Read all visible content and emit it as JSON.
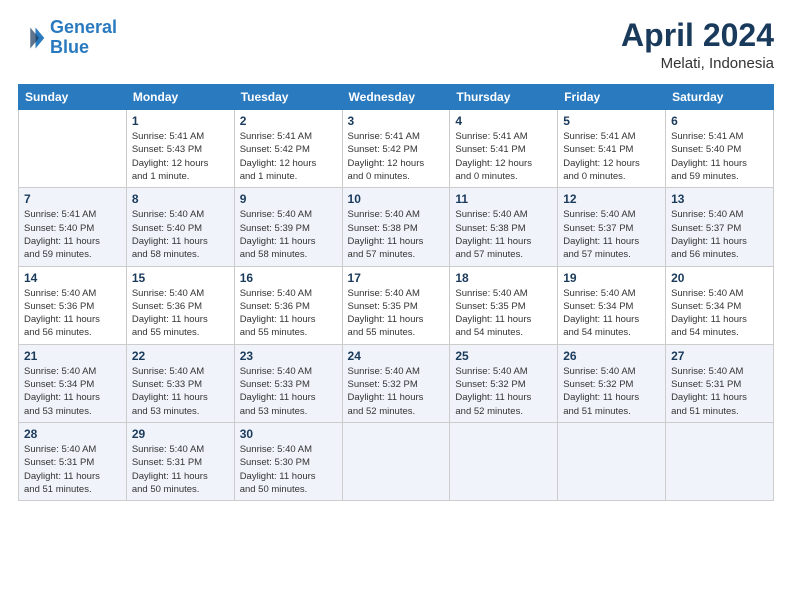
{
  "header": {
    "logo_line1": "General",
    "logo_line2": "Blue",
    "month": "April 2024",
    "location": "Melati, Indonesia"
  },
  "days_of_week": [
    "Sunday",
    "Monday",
    "Tuesday",
    "Wednesday",
    "Thursday",
    "Friday",
    "Saturday"
  ],
  "weeks": [
    [
      {
        "day": "",
        "info": ""
      },
      {
        "day": "1",
        "info": "Sunrise: 5:41 AM\nSunset: 5:43 PM\nDaylight: 12 hours\nand 1 minute."
      },
      {
        "day": "2",
        "info": "Sunrise: 5:41 AM\nSunset: 5:42 PM\nDaylight: 12 hours\nand 1 minute."
      },
      {
        "day": "3",
        "info": "Sunrise: 5:41 AM\nSunset: 5:42 PM\nDaylight: 12 hours\nand 0 minutes."
      },
      {
        "day": "4",
        "info": "Sunrise: 5:41 AM\nSunset: 5:41 PM\nDaylight: 12 hours\nand 0 minutes."
      },
      {
        "day": "5",
        "info": "Sunrise: 5:41 AM\nSunset: 5:41 PM\nDaylight: 12 hours\nand 0 minutes."
      },
      {
        "day": "6",
        "info": "Sunrise: 5:41 AM\nSunset: 5:40 PM\nDaylight: 11 hours\nand 59 minutes."
      }
    ],
    [
      {
        "day": "7",
        "info": "Sunrise: 5:41 AM\nSunset: 5:40 PM\nDaylight: 11 hours\nand 59 minutes."
      },
      {
        "day": "8",
        "info": "Sunrise: 5:40 AM\nSunset: 5:40 PM\nDaylight: 11 hours\nand 58 minutes."
      },
      {
        "day": "9",
        "info": "Sunrise: 5:40 AM\nSunset: 5:39 PM\nDaylight: 11 hours\nand 58 minutes."
      },
      {
        "day": "10",
        "info": "Sunrise: 5:40 AM\nSunset: 5:38 PM\nDaylight: 11 hours\nand 57 minutes."
      },
      {
        "day": "11",
        "info": "Sunrise: 5:40 AM\nSunset: 5:38 PM\nDaylight: 11 hours\nand 57 minutes."
      },
      {
        "day": "12",
        "info": "Sunrise: 5:40 AM\nSunset: 5:37 PM\nDaylight: 11 hours\nand 57 minutes."
      },
      {
        "day": "13",
        "info": "Sunrise: 5:40 AM\nSunset: 5:37 PM\nDaylight: 11 hours\nand 56 minutes."
      }
    ],
    [
      {
        "day": "14",
        "info": "Sunrise: 5:40 AM\nSunset: 5:36 PM\nDaylight: 11 hours\nand 56 minutes."
      },
      {
        "day": "15",
        "info": "Sunrise: 5:40 AM\nSunset: 5:36 PM\nDaylight: 11 hours\nand 55 minutes."
      },
      {
        "day": "16",
        "info": "Sunrise: 5:40 AM\nSunset: 5:36 PM\nDaylight: 11 hours\nand 55 minutes."
      },
      {
        "day": "17",
        "info": "Sunrise: 5:40 AM\nSunset: 5:35 PM\nDaylight: 11 hours\nand 55 minutes."
      },
      {
        "day": "18",
        "info": "Sunrise: 5:40 AM\nSunset: 5:35 PM\nDaylight: 11 hours\nand 54 minutes."
      },
      {
        "day": "19",
        "info": "Sunrise: 5:40 AM\nSunset: 5:34 PM\nDaylight: 11 hours\nand 54 minutes."
      },
      {
        "day": "20",
        "info": "Sunrise: 5:40 AM\nSunset: 5:34 PM\nDaylight: 11 hours\nand 54 minutes."
      }
    ],
    [
      {
        "day": "21",
        "info": "Sunrise: 5:40 AM\nSunset: 5:34 PM\nDaylight: 11 hours\nand 53 minutes."
      },
      {
        "day": "22",
        "info": "Sunrise: 5:40 AM\nSunset: 5:33 PM\nDaylight: 11 hours\nand 53 minutes."
      },
      {
        "day": "23",
        "info": "Sunrise: 5:40 AM\nSunset: 5:33 PM\nDaylight: 11 hours\nand 53 minutes."
      },
      {
        "day": "24",
        "info": "Sunrise: 5:40 AM\nSunset: 5:32 PM\nDaylight: 11 hours\nand 52 minutes."
      },
      {
        "day": "25",
        "info": "Sunrise: 5:40 AM\nSunset: 5:32 PM\nDaylight: 11 hours\nand 52 minutes."
      },
      {
        "day": "26",
        "info": "Sunrise: 5:40 AM\nSunset: 5:32 PM\nDaylight: 11 hours\nand 51 minutes."
      },
      {
        "day": "27",
        "info": "Sunrise: 5:40 AM\nSunset: 5:31 PM\nDaylight: 11 hours\nand 51 minutes."
      }
    ],
    [
      {
        "day": "28",
        "info": "Sunrise: 5:40 AM\nSunset: 5:31 PM\nDaylight: 11 hours\nand 51 minutes."
      },
      {
        "day": "29",
        "info": "Sunrise: 5:40 AM\nSunset: 5:31 PM\nDaylight: 11 hours\nand 50 minutes."
      },
      {
        "day": "30",
        "info": "Sunrise: 5:40 AM\nSunset: 5:30 PM\nDaylight: 11 hours\nand 50 minutes."
      },
      {
        "day": "",
        "info": ""
      },
      {
        "day": "",
        "info": ""
      },
      {
        "day": "",
        "info": ""
      },
      {
        "day": "",
        "info": ""
      }
    ]
  ]
}
